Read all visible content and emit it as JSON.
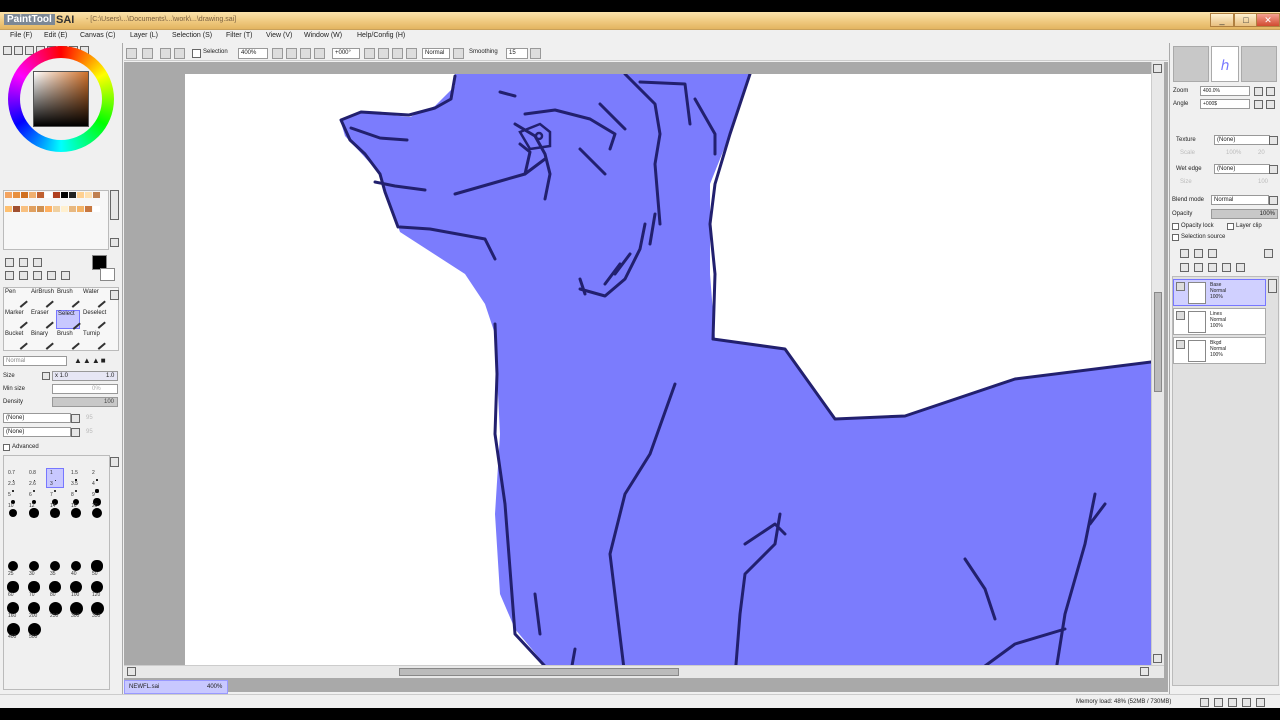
{
  "window": {
    "app_badge": "PaintTool",
    "app_name": "SAI",
    "title_path": "- [C:\\Users\\...\\Documents\\...\\work\\...\\drawing.sai]",
    "controls": [
      "_",
      "□",
      "✕"
    ]
  },
  "menu": [
    {
      "label": "File (F)"
    },
    {
      "label": "Edit (E)"
    },
    {
      "label": "Canvas (C)"
    },
    {
      "label": "Layer (L)"
    },
    {
      "label": "Selection (S)"
    },
    {
      "label": "Filter (T)"
    },
    {
      "label": "View (V)"
    },
    {
      "label": "Window (W)"
    },
    {
      "label": "Help/Config (H)"
    }
  ],
  "toolbar": {
    "selection_label": "Selection",
    "zoom": "400%",
    "angle": "+000°",
    "blend": "Normal",
    "smoothing_label": "Smoothing",
    "smoothing_value": "15"
  },
  "tools": {
    "rows": [
      [
        "Pen",
        "AirBrush",
        "Brush",
        "Water"
      ],
      [
        "Marker",
        "Eraser",
        "Select",
        "Deselect"
      ],
      [
        "Bucket",
        "Binary",
        "Brush",
        "Turnip"
      ]
    ],
    "selected": "Select"
  },
  "brush_settings": {
    "mode": "Normal",
    "size_label": "Size",
    "size_mult": "x 1.0",
    "size_value": "1.0",
    "min_size_label": "Min size",
    "min_size_value": "0%",
    "density_label": "Density",
    "density_value": "100",
    "texture1": "(None)",
    "texture1_value": "95",
    "texture2": "(None)",
    "texture2_value": "95",
    "advanced_label": "Advanced"
  },
  "brush_sizes": [
    "0.7",
    "0.8",
    "1",
    "1.5",
    "2",
    "2.3",
    "2.6",
    "3",
    "3.5",
    "4",
    "5",
    "6",
    "7",
    "8",
    "9",
    "10",
    "12",
    "14",
    "16",
    "20",
    "25",
    "30",
    "35",
    "40",
    "50",
    "60",
    "70",
    "80",
    "100",
    "120",
    "160",
    "200",
    "250",
    "300",
    "350",
    "400",
    "500"
  ],
  "right_panel": {
    "zoom_label": "Zoom",
    "zoom_value": "400.0%",
    "angle_label": "Angle",
    "angle_value": "+000$",
    "texture_label": "Texture",
    "texture_value": "(None)",
    "scale_label": "Scale",
    "scale_value": "100%",
    "strength_value": "20",
    "wet_edge_label": "Wet edge",
    "wet_edge_value": "(None)",
    "wet_size_label": "Size",
    "wet_size_value": "100",
    "blend_label": "Blend mode",
    "blend_value": "Normal",
    "opacity_label": "Opacity",
    "opacity_value": "100%",
    "opacity_lock_label": "Opacity lock",
    "layer_clip_label": "Layer clip",
    "selection_source_label": "Selection source"
  },
  "layers": [
    {
      "name": "Base",
      "mode": "Normal",
      "opacity": "100%",
      "selected": true
    },
    {
      "name": "Lines",
      "mode": "Normal",
      "opacity": "100%",
      "selected": false
    },
    {
      "name": "Bkgd",
      "mode": "Normal",
      "opacity": "100%",
      "selected": false
    }
  ],
  "doc_tab": {
    "name": "NEWFL.sai",
    "zoom": "400%"
  },
  "status": {
    "text": "Memory load: 48% (52MB / 730MB)"
  },
  "colors": {
    "fill": "#7b7cfd",
    "line": "#22206e",
    "accent": "#e3b561"
  }
}
